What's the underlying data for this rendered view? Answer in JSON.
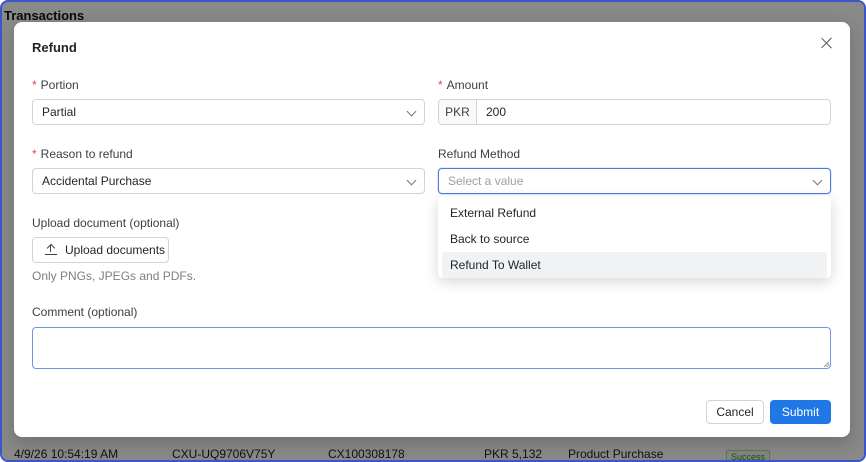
{
  "background": {
    "title": "Transactions",
    "row": {
      "datetime": "4/9/26 10:54:19 AM",
      "ref": "CXU-UQ9706V75Y",
      "customer_id": "CX100308178",
      "amount": "PKR 5,132",
      "type": "Product Purchase",
      "status": "Success"
    }
  },
  "modal": {
    "title": "Refund",
    "portion": {
      "label": "Portion",
      "value": "Partial"
    },
    "amount": {
      "label": "Amount",
      "currency": "PKR",
      "value": "200"
    },
    "reason": {
      "label": "Reason to refund",
      "value": "Accidental Purchase"
    },
    "refund_method": {
      "label": "Refund Method",
      "placeholder": "Select a value",
      "options": [
        "External Refund",
        "Back to source",
        "Refund To Wallet"
      ]
    },
    "upload": {
      "label": "Upload document (optional)",
      "button": "Upload documents",
      "hint": "Only PNGs, JPEGs and PDFs."
    },
    "comment": {
      "label": "Comment (optional)",
      "value": ""
    },
    "actions": {
      "cancel": "Cancel",
      "submit": "Submit"
    }
  },
  "colors": {
    "primary": "#1f78e6",
    "required": "#e5484d",
    "focus": "#4a7bd9"
  }
}
